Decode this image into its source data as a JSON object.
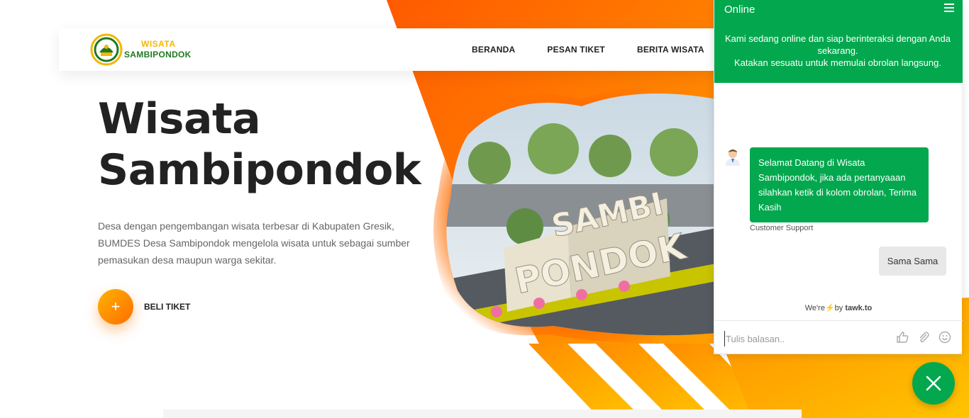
{
  "brand": {
    "logo_line1": "WISATA",
    "logo_line2": "SAMBIPONDOK",
    "logo_icon": "village-seal-logo"
  },
  "nav": {
    "items": [
      {
        "label": "BERANDA"
      },
      {
        "label": "PESAN TIKET"
      },
      {
        "label": "BERITA WISATA"
      }
    ]
  },
  "hero": {
    "title_line1": "Wisata",
    "title_line2": "Sambipondok",
    "description": "Desa dengan pengembangan wisata terbesar di Kabupaten Gresik, BUMDES Desa Sambipondok mengelola wisata untuk sebagai sumber pemasukan desa maupun warga sekitar.",
    "cta_icon": "plus-icon",
    "cta_label": "BELI TIKET",
    "image_sign_text": "SAMBI PONDOK"
  },
  "chat": {
    "status": "Online",
    "intro_line1": "Kami sedang online dan siap berinteraksi dengan Anda sekarang.",
    "intro_line2": "Katakan sesuatu untuk memulai obrolan langsung.",
    "agent_message": "Selamat Datang di Wisata Sambipondok, jika ada pertanyaaan silahkan ketik di kolom obrolan, Terima Kasih",
    "agent_name": "Customer Support",
    "user_message": "Sama Sama",
    "powered_prefix": "We're",
    "powered_by": "by",
    "powered_brand": "tawk.to",
    "input_placeholder": "Tulis balasan..",
    "input_value": ""
  },
  "colors": {
    "accent_orange": "#ff6d00",
    "accent_yellow": "#ffb300",
    "chat_green": "#03a84e",
    "logo_green": "#1f7a1f",
    "logo_yellow": "#f2b705"
  }
}
